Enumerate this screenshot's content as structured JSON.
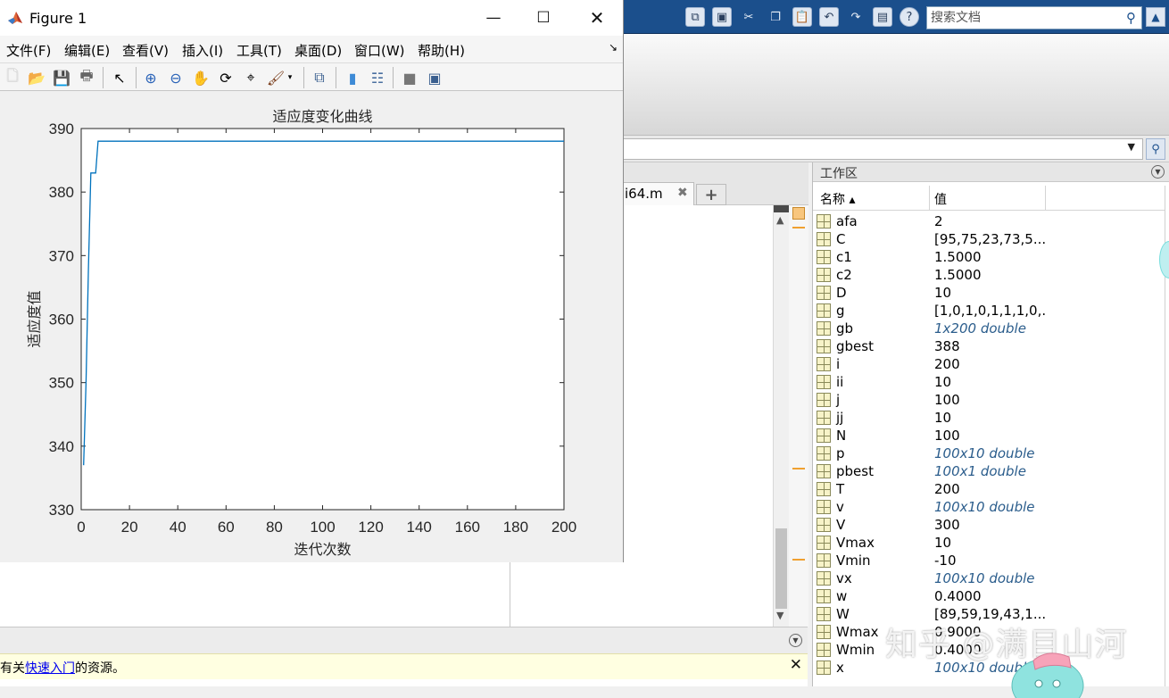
{
  "matlab": {
    "search_placeholder": "搜索文档",
    "quick_access_icons": [
      "layout-icon",
      "save-icon",
      "cut-icon",
      "copy-icon",
      "paste-icon",
      "undo-icon",
      "redo-icon",
      "switch-windows-icon",
      "help-icon"
    ],
    "editor_tab_label": "i64.m",
    "notification": {
      "prefix": "有关",
      "link": "快速入门",
      "suffix": "的资源。"
    },
    "workspace": {
      "title": "工作区",
      "col_name": "名称 ▴",
      "col_value": "值",
      "variables": [
        {
          "name": "afa",
          "value": "2",
          "italic": false
        },
        {
          "name": "C",
          "value": "[95,75,23,73,5...",
          "italic": false
        },
        {
          "name": "c1",
          "value": "1.5000",
          "italic": false
        },
        {
          "name": "c2",
          "value": "1.5000",
          "italic": false
        },
        {
          "name": "D",
          "value": "10",
          "italic": false
        },
        {
          "name": "g",
          "value": "[1,0,1,0,1,1,1,0,...",
          "italic": false
        },
        {
          "name": "gb",
          "value": "1x200 double",
          "italic": true
        },
        {
          "name": "gbest",
          "value": "388",
          "italic": false
        },
        {
          "name": "i",
          "value": "200",
          "italic": false
        },
        {
          "name": "ii",
          "value": "10",
          "italic": false
        },
        {
          "name": "j",
          "value": "100",
          "italic": false
        },
        {
          "name": "jj",
          "value": "10",
          "italic": false
        },
        {
          "name": "N",
          "value": "100",
          "italic": false
        },
        {
          "name": "p",
          "value": "100x10 double",
          "italic": true
        },
        {
          "name": "pbest",
          "value": "100x1 double",
          "italic": true
        },
        {
          "name": "T",
          "value": "200",
          "italic": false
        },
        {
          "name": "v",
          "value": "100x10 double",
          "italic": true
        },
        {
          "name": "V",
          "value": "300",
          "italic": false
        },
        {
          "name": "Vmax",
          "value": "10",
          "italic": false
        },
        {
          "name": "Vmin",
          "value": "-10",
          "italic": false
        },
        {
          "name": "vx",
          "value": "100x10 double",
          "italic": true
        },
        {
          "name": "w",
          "value": "0.4000",
          "italic": false
        },
        {
          "name": "W",
          "value": "[89,59,19,43,1...",
          "italic": false
        },
        {
          "name": "Wmax",
          "value": "0.9000",
          "italic": false
        },
        {
          "name": "Wmin",
          "value": "0.4000",
          "italic": false
        },
        {
          "name": "x",
          "value": "100x10 double",
          "italic": true
        }
      ]
    },
    "watermark": "知乎 @满目山河"
  },
  "figure": {
    "title": "Figure 1",
    "menu": [
      "文件(F)",
      "编辑(E)",
      "查看(V)",
      "插入(I)",
      "工具(T)",
      "桌面(D)",
      "窗口(W)",
      "帮助(H)"
    ],
    "toolbar_icons": [
      "new-figure-icon",
      "open-icon",
      "save-icon",
      "print-icon",
      "pointer-icon",
      "zoom-in-icon",
      "zoom-out-icon",
      "pan-hand-icon",
      "rotate-3d-icon",
      "data-cursor-icon",
      "brush-icon",
      "link-plot-icon",
      "colorbar-icon",
      "legend-icon",
      "hide-plot-tools-icon",
      "show-plot-tools-icon"
    ]
  },
  "chart_data": {
    "type": "line",
    "title": "适应度变化曲线",
    "xlabel": "迭代次数",
    "ylabel": "适应度值",
    "xlim": [
      0,
      200
    ],
    "ylim": [
      330,
      390
    ],
    "xticks": [
      0,
      20,
      40,
      60,
      80,
      100,
      120,
      140,
      160,
      180,
      200
    ],
    "yticks": [
      330,
      340,
      350,
      360,
      370,
      380,
      390
    ],
    "grid": false,
    "line_color": "#0072BD",
    "series": [
      {
        "x": [
          1,
          2,
          3,
          4,
          5,
          6,
          7,
          200
        ],
        "y": [
          337,
          350,
          368,
          383,
          383,
          383,
          388,
          388
        ]
      }
    ]
  }
}
